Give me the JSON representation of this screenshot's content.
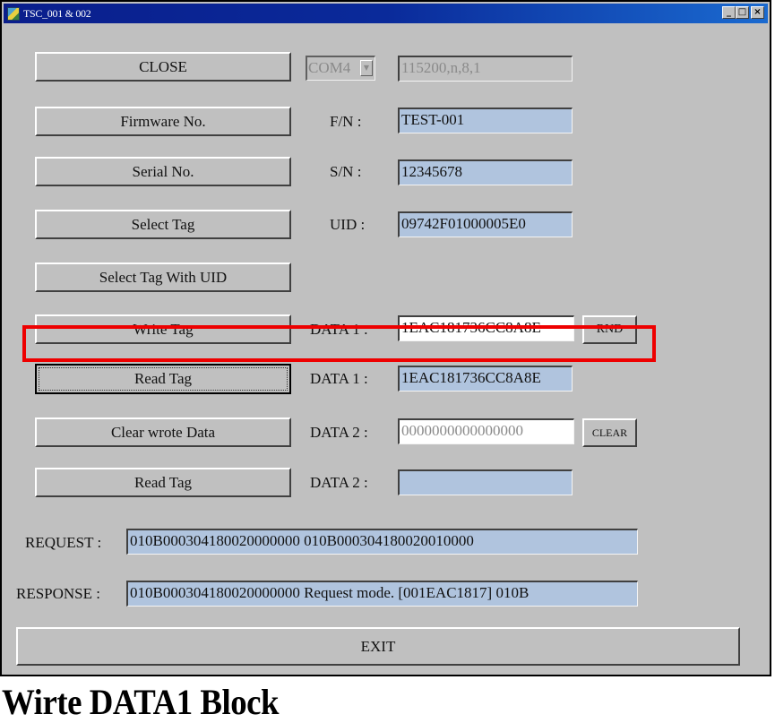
{
  "window": {
    "title": "TSC_001 & 002",
    "controls": {
      "minimize": "_",
      "maximize": "□",
      "close": "×"
    }
  },
  "connection": {
    "close_button": "CLOSE",
    "port": "COM4",
    "port_arrow": "▼",
    "settings": "115200,n,8,1"
  },
  "rows": {
    "firmware": {
      "button": "Firmware No.",
      "label": "F/N :",
      "value": "TEST-001"
    },
    "serial": {
      "button": "Serial No.",
      "label": "S/N :",
      "value": " 12345678"
    },
    "select_tag": {
      "button": "Select Tag",
      "label": "UID :",
      "value": "09742F01000005E0"
    },
    "select_uid": {
      "button": "Select Tag With UID"
    },
    "write_tag": {
      "button": "Write Tag",
      "label": "DATA 1 :",
      "value": "1EAC181736CC8A8E",
      "rnd_button": "RND"
    },
    "read_tag_1": {
      "button": "Read Tag",
      "label": "DATA 1 :",
      "value": "1EAC181736CC8A8E"
    },
    "clear_data": {
      "button": "Clear wrote Data",
      "label": "DATA 2 :",
      "value": "0000000000000000",
      "clear_button": "CLEAR"
    },
    "read_tag_2": {
      "button": "Read Tag",
      "label": "DATA 2 :",
      "value": ""
    }
  },
  "log": {
    "request_label": "REQUEST :",
    "request_value": "010B000304180020000000   010B000304180020010000",
    "response_label": "RESPONSE :",
    "response_value": "010B000304180020000000  Request mode.  [001EAC1817]    010B"
  },
  "exit_button": "EXIT",
  "caption": "Wirte DATA1 Block",
  "colors": {
    "window_bg": "#c0c0c0",
    "field_blue": "#b0c4de",
    "titlebar": "#0a1e8c",
    "highlight": "#ee0000"
  }
}
